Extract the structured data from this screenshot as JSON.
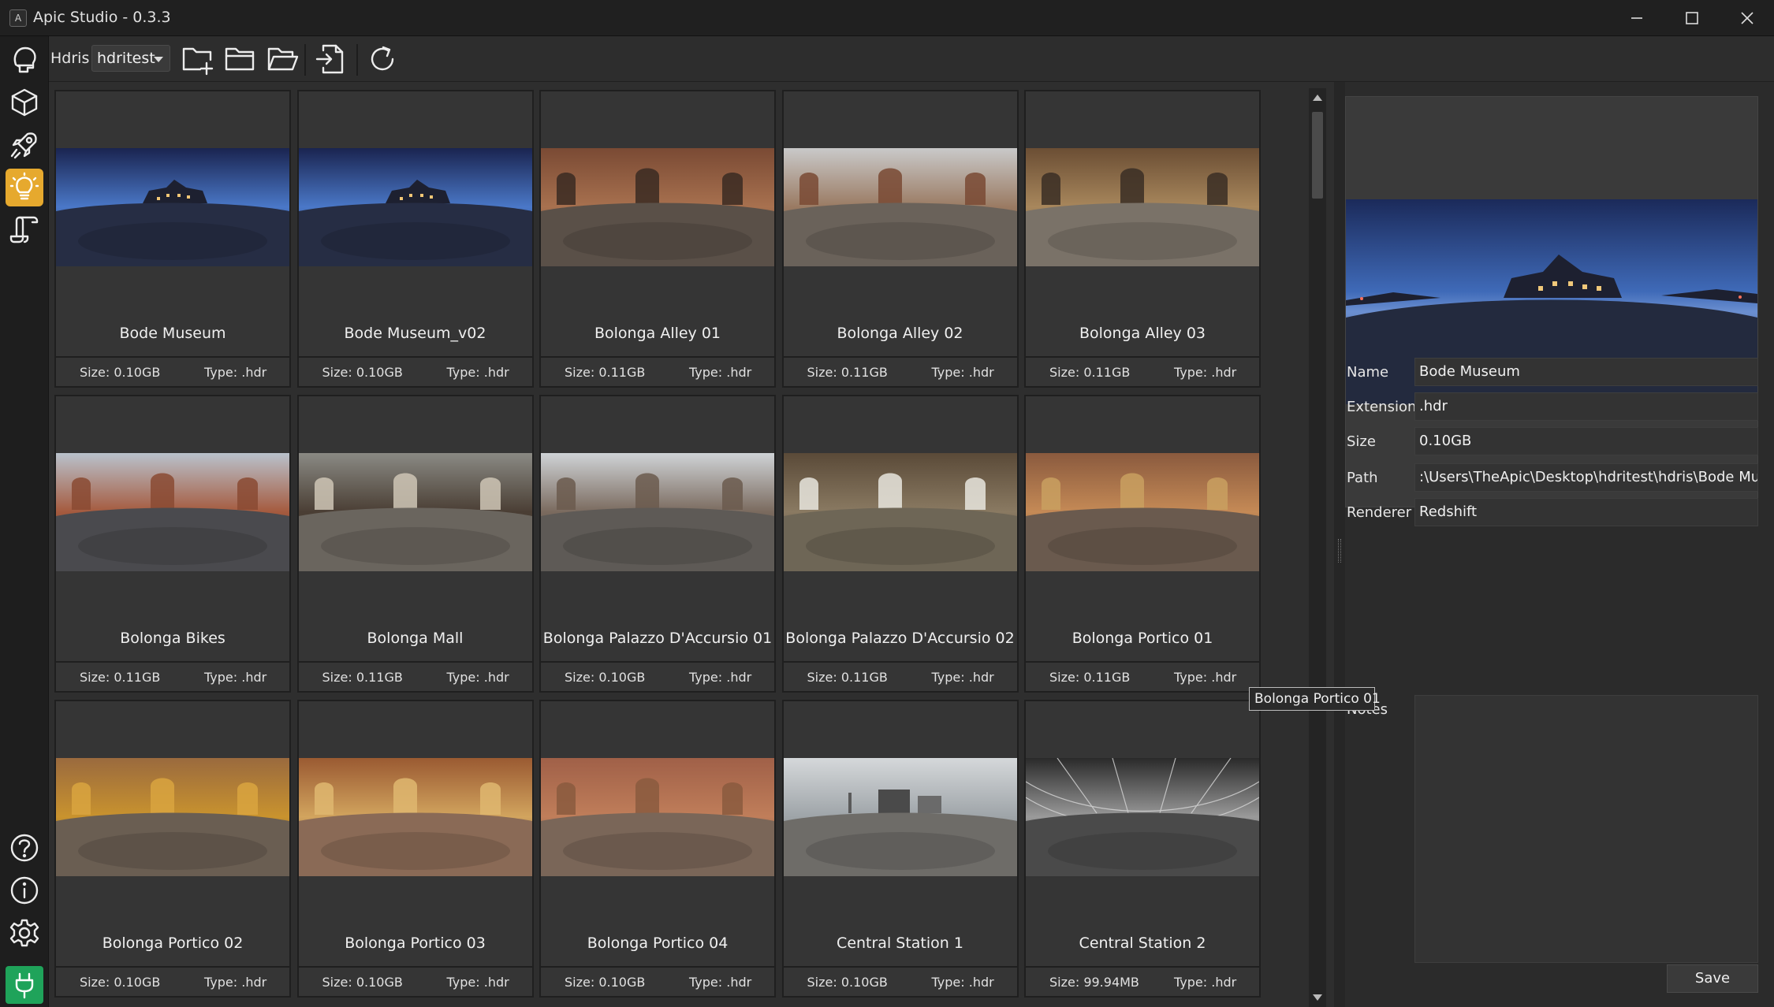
{
  "window": {
    "title": "Apic Studio - 0.3.3",
    "app_icon": "app-logo-icon",
    "controls": [
      "minimize-icon",
      "maximize-icon",
      "close-icon"
    ]
  },
  "sidebar": {
    "top_items": [
      {
        "name": "head-icon",
        "active": false
      },
      {
        "name": "cube-icon",
        "active": false
      },
      {
        "name": "rocket-icon",
        "active": false
      },
      {
        "name": "lightbulb-icon",
        "active": true
      },
      {
        "name": "scroll-icon",
        "active": false
      }
    ],
    "bottom_items": [
      "help-icon",
      "info-icon",
      "settings-icon",
      "plug-icon"
    ],
    "accent_color": "#e6a92e",
    "plug_color": "#1fa35a"
  },
  "toolbar": {
    "label": "Hdris",
    "library_select": "hdritest",
    "buttons": [
      "new-folder-icon",
      "folder-icon",
      "open-folder-icon",
      "import-file-icon",
      "refresh-icon"
    ]
  },
  "grid": {
    "items": [
      {
        "name": "Bode Museum",
        "size": "Size: 0.10GB",
        "type": "Type: .hdr",
        "thumb": "night"
      },
      {
        "name": "Bode Museum_v02",
        "size": "Size: 0.10GB",
        "type": "Type: .hdr",
        "thumb": "night"
      },
      {
        "name": "Bolonga Alley 01",
        "size": "Size: 0.11GB",
        "type": "Type: .hdr",
        "thumb": "alley"
      },
      {
        "name": "Bolonga Alley 02",
        "size": "Size: 0.11GB",
        "type": "Type: .hdr",
        "thumb": "alley2"
      },
      {
        "name": "Bolonga Alley 03",
        "size": "Size: 0.11GB",
        "type": "Type: .hdr",
        "thumb": "alley3"
      },
      {
        "name": "Bolonga Bikes",
        "size": "Size: 0.11GB",
        "type": "Type: .hdr",
        "thumb": "bikes"
      },
      {
        "name": "Bolonga Mall",
        "size": "Size: 0.11GB",
        "type": "Type: .hdr",
        "thumb": "mall"
      },
      {
        "name": "Bolonga Palazzo D'Accursio 01",
        "size": "Size: 0.10GB",
        "type": "Type: .hdr",
        "thumb": "palazzo"
      },
      {
        "name": "Bolonga Palazzo D'Accursio 02",
        "size": "Size: 0.11GB",
        "type": "Type: .hdr",
        "thumb": "arch"
      },
      {
        "name": "Bolonga Portico 01",
        "size": "Size: 0.11GB",
        "type": "Type: .hdr",
        "thumb": "portico"
      },
      {
        "name": "Bolonga Portico 02",
        "size": "Size: 0.10GB",
        "type": "Type: .hdr",
        "thumb": "portico2"
      },
      {
        "name": "Bolonga Portico 03",
        "size": "Size: 0.10GB",
        "type": "Type: .hdr",
        "thumb": "portico3"
      },
      {
        "name": "Bolonga Portico 04",
        "size": "Size: 0.10GB",
        "type": "Type: .hdr",
        "thumb": "portico4"
      },
      {
        "name": "Central Station 1",
        "size": "Size: 0.10GB",
        "type": "Type: .hdr",
        "thumb": "station"
      },
      {
        "name": "Central Station 2",
        "size": "Size: 99.94MB",
        "type": "Type: .hdr",
        "thumb": "station2"
      }
    ]
  },
  "details": {
    "name_label": "Name",
    "name_value": "Bode Museum",
    "extension_label": "Extension",
    "extension_value": ".hdr",
    "size_label": "Size",
    "size_value": "0.10GB",
    "path_label": "Path",
    "path_value": ":\\Users\\TheApic\\Desktop\\hdritest\\hdris\\Bode Museum",
    "renderer_label": "Renderer",
    "renderer_value": "Redshift",
    "notes_label": "Notes",
    "notes_value": "",
    "save_label": "Save"
  },
  "tooltip": "Bolonga Portico 01"
}
